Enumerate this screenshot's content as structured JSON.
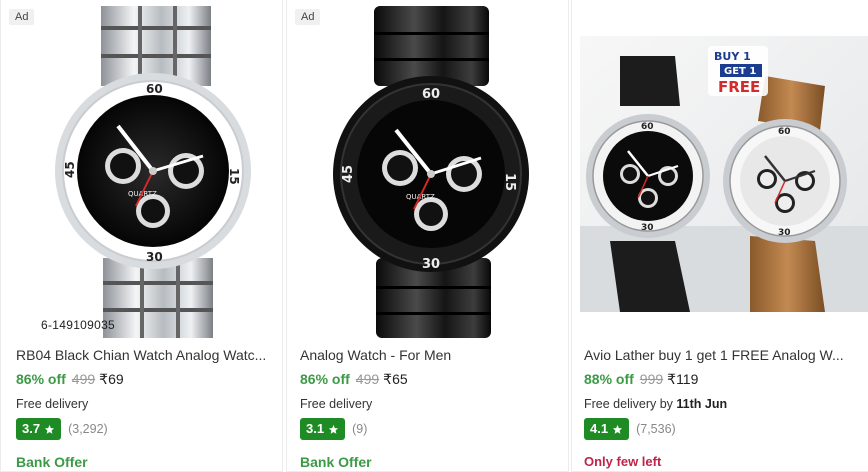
{
  "products": [
    {
      "ad_label": "Ad",
      "watermark": "6-149109035",
      "title": "RB04 Black Chian Watch Analog Watc...",
      "discount": "86% off",
      "mrp": "499",
      "price": "₹69",
      "delivery": "Free delivery",
      "delivery_date": "",
      "rating": "3.7",
      "rating_count": "(3,292)",
      "offer": "Bank Offer",
      "offer_color": "#3c9a46"
    },
    {
      "ad_label": "Ad",
      "title": "Analog Watch - For Men",
      "discount": "86% off",
      "mrp": "499",
      "price": "₹65",
      "delivery": "Free delivery",
      "delivery_date": "",
      "rating": "3.1",
      "rating_count": "(9)",
      "offer": "Bank Offer",
      "offer_color": "#3c9a46"
    },
    {
      "title": "Avio Lather buy 1 get 1 FREE Analog W...",
      "discount": "88% off",
      "mrp": "999",
      "price": "₹119",
      "delivery": "Free delivery by",
      "delivery_date": "11th Jun",
      "rating": "4.1",
      "rating_count": "(7,536)",
      "offer": "Only few left",
      "offer_color": "#c0224a",
      "promo_badge_line1": "BUY 1",
      "promo_badge_line2": "GET 1",
      "promo_badge_line3": "FREE"
    }
  ],
  "colors": {
    "discount_green": "#3c9a46",
    "rating_green": "#1f8b24",
    "urgent_red": "#c0224a",
    "tab_accent": "#5f3dc4"
  },
  "dial_numbers": [
    "60",
    "15",
    "30",
    "45"
  ],
  "brand_text": "QUARTZ"
}
